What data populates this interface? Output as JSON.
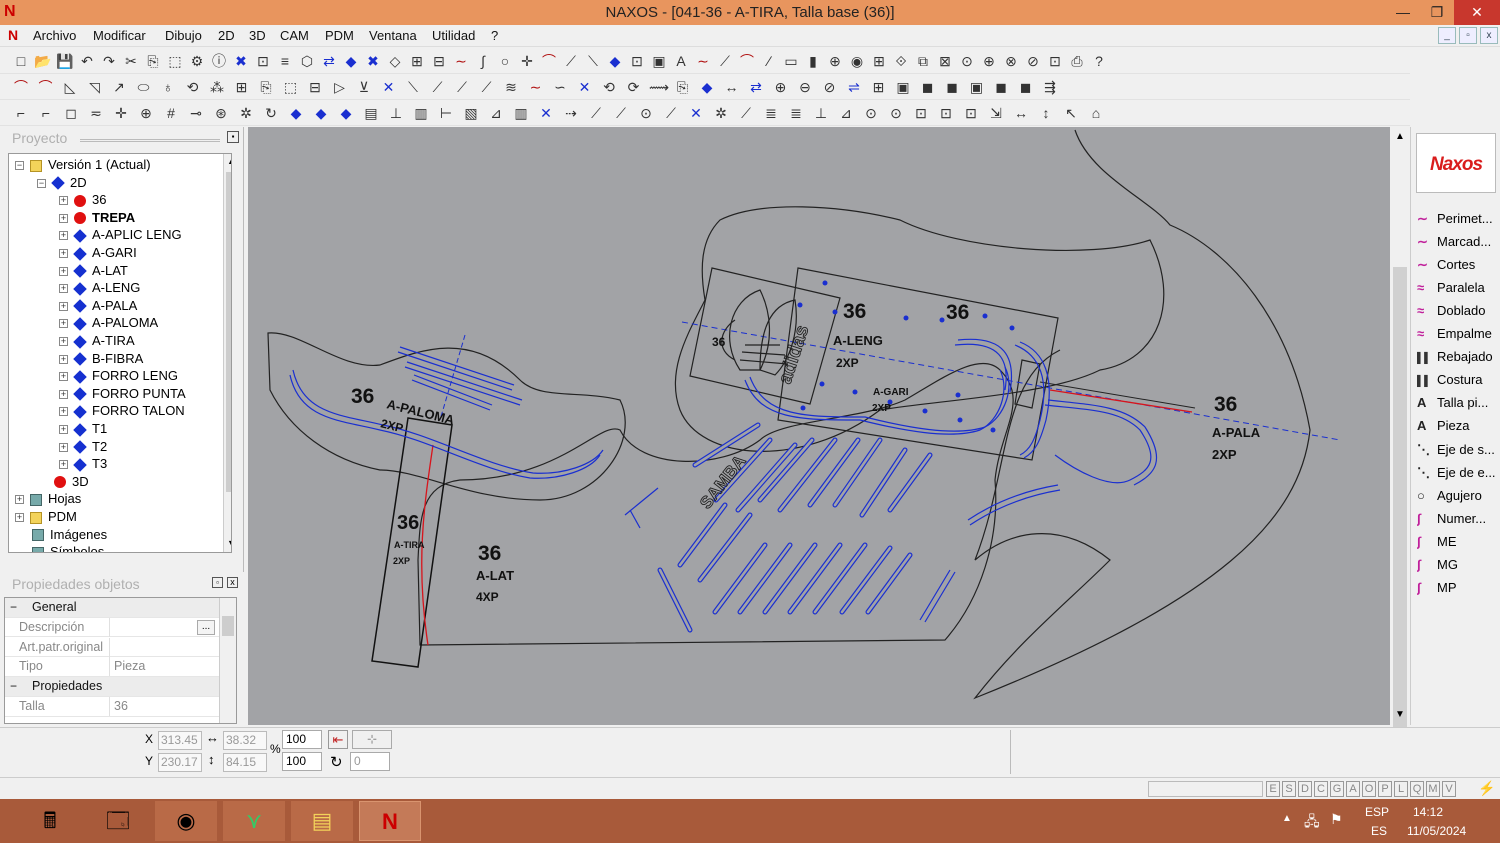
{
  "window": {
    "title": "NAXOS - [041-36 - A-TIRA, Talla base (36)]",
    "minimize": "—",
    "restore": "❐",
    "close": "✕",
    "app_letter": "N"
  },
  "menu": [
    "Archivo",
    "Modificar",
    "Dibujo",
    "2D",
    "3D",
    "CAM",
    "PDM",
    "Ventana",
    "Utilidad",
    "?"
  ],
  "mdi_controls": [
    "_",
    "▫",
    "x"
  ],
  "project_panel": {
    "title": "Proyecto",
    "tree": [
      {
        "label": "Versión 1 (Actual)",
        "indent": 0,
        "icon": "version-icon",
        "expander": "−",
        "bold": false
      },
      {
        "label": "2D",
        "indent": 1,
        "icon": "2d-icon",
        "expander": "−",
        "bold": false
      },
      {
        "label": "36",
        "indent": 2,
        "icon": "size-red-dot-icon",
        "expander": "+",
        "bold": false
      },
      {
        "label": "TREPA",
        "indent": 2,
        "icon": "size-red-dot-icon",
        "expander": "+",
        "bold": true
      },
      {
        "label": "A-APLIC LENG",
        "indent": 2,
        "icon": "piece-diamond-icon",
        "expander": "+",
        "bold": false
      },
      {
        "label": "A-GARI",
        "indent": 2,
        "icon": "piece-diamond-icon",
        "expander": "+",
        "bold": false
      },
      {
        "label": "A-LAT",
        "indent": 2,
        "icon": "piece-diamond-icon",
        "expander": "+",
        "bold": false
      },
      {
        "label": "A-LENG",
        "indent": 2,
        "icon": "piece-diamond-icon",
        "expander": "+",
        "bold": false
      },
      {
        "label": "A-PALA",
        "indent": 2,
        "icon": "piece-diamond-icon",
        "expander": "+",
        "bold": false
      },
      {
        "label": "A-PALOMA",
        "indent": 2,
        "icon": "piece-diamond-icon",
        "expander": "+",
        "bold": false
      },
      {
        "label": "A-TIRA",
        "indent": 2,
        "icon": "piece-diamond-icon",
        "expander": "+",
        "bold": false
      },
      {
        "label": "B-FIBRA",
        "indent": 2,
        "icon": "piece-diamond-icon",
        "expander": "+",
        "bold": false
      },
      {
        "label": "FORRO LENG",
        "indent": 2,
        "icon": "piece-diamond-icon",
        "expander": "+",
        "bold": false
      },
      {
        "label": "FORRO PUNTA",
        "indent": 2,
        "icon": "piece-diamond-icon",
        "expander": "+",
        "bold": false
      },
      {
        "label": "FORRO TALON",
        "indent": 2,
        "icon": "piece-diamond-icon",
        "expander": "+",
        "bold": false
      },
      {
        "label": "T1",
        "indent": 2,
        "icon": "piece-diamond-icon",
        "expander": "+",
        "bold": false
      },
      {
        "label": "T2",
        "indent": 2,
        "icon": "piece-diamond-icon",
        "expander": "+",
        "bold": false
      },
      {
        "label": "T3",
        "indent": 2,
        "icon": "piece-diamond-icon",
        "expander": "+",
        "bold": false
      },
      {
        "label": "3D",
        "indent": 1,
        "icon": "3d-icon",
        "expander": "",
        "bold": false
      },
      {
        "label": "Hojas",
        "indent": 0,
        "icon": "sheets-icon",
        "expander": "+",
        "bold": false
      },
      {
        "label": "PDM",
        "indent": 0,
        "icon": "folder-icon",
        "expander": "+",
        "bold": false
      },
      {
        "label": "Imágenes",
        "indent": 0,
        "icon": "images-icon",
        "expander": "",
        "bold": false
      },
      {
        "label": "Símbolos",
        "indent": 0,
        "icon": "symbols-icon",
        "expander": "",
        "bold": false
      }
    ]
  },
  "props_panel": {
    "title": "Propiedades objetos",
    "rows": [
      {
        "type": "section",
        "label": "General"
      },
      {
        "type": "field",
        "label": "Descripción",
        "value": "",
        "button": "..."
      },
      {
        "type": "field",
        "label": "Art.patr.original",
        "value": ""
      },
      {
        "type": "field",
        "label": "Tipo",
        "value": "Pieza"
      },
      {
        "type": "section",
        "label": "Propiedades"
      },
      {
        "type": "field",
        "label": "Talla",
        "value": "36"
      }
    ]
  },
  "right_panel": {
    "logo": "Naxos",
    "tools": [
      {
        "icon": "∼",
        "label": "Perimet..."
      },
      {
        "icon": "∼",
        "label": "Marcad..."
      },
      {
        "icon": "∼",
        "label": "Cortes"
      },
      {
        "icon": "≈",
        "label": "Paralela"
      },
      {
        "icon": "≈",
        "label": "Doblado"
      },
      {
        "icon": "≈",
        "label": "Empalme"
      },
      {
        "icon": "▌▌",
        "label": "Rebajado"
      },
      {
        "icon": "▌▌",
        "label": "Costura"
      },
      {
        "icon": "A",
        "label": "Talla pi..."
      },
      {
        "icon": "A",
        "label": "Pieza"
      },
      {
        "icon": "⋱",
        "label": "Eje de s..."
      },
      {
        "icon": "⋱",
        "label": "Eje de e..."
      },
      {
        "icon": "○",
        "label": "Agujero"
      },
      {
        "icon": "∫",
        "label": "Numer..."
      },
      {
        "icon": "∫",
        "label": "ME"
      },
      {
        "icon": "∫",
        "label": "MG"
      },
      {
        "icon": "∫",
        "label": "MP"
      }
    ]
  },
  "canvas_labels": [
    {
      "text": "36",
      "cls": "size"
    },
    {
      "text": "36",
      "cls": "size"
    },
    {
      "text": "36",
      "cls": "small"
    },
    {
      "text": "A-LENG",
      "cls": "name"
    },
    {
      "text": "2XP",
      "cls": "name"
    },
    {
      "text": "A-GARI",
      "cls": "tiny"
    },
    {
      "text": "2XP",
      "cls": "tiny"
    },
    {
      "text": "36",
      "cls": "size"
    },
    {
      "text": "A-PALA",
      "cls": "name"
    },
    {
      "text": "2XP",
      "cls": "name"
    },
    {
      "text": "36",
      "cls": "size"
    },
    {
      "text": "A-PALOMA",
      "cls": "name"
    },
    {
      "text": "2XP",
      "cls": "name"
    },
    {
      "text": "36",
      "cls": "size"
    },
    {
      "text": "A-TIRA",
      "cls": "tiny"
    },
    {
      "text": "2XP",
      "cls": "tiny"
    },
    {
      "text": "36",
      "cls": "size"
    },
    {
      "text": "A-LAT",
      "cls": "name"
    },
    {
      "text": "4XP",
      "cls": "name"
    },
    {
      "text": "SAMBA",
      "cls": "brand"
    },
    {
      "text": "adidas",
      "cls": "brand"
    }
  ],
  "status": {
    "x_label": "X",
    "x_value": "313.45",
    "y_label": "Y",
    "y_value": "230.17",
    "w_value": "38.32",
    "h_value": "84.15",
    "percent_sign": "%",
    "scale_x": "100",
    "scale_y": "100",
    "rotation": "0",
    "modes": [
      "E",
      "S",
      "D",
      "C",
      "G",
      "A",
      "O",
      "P",
      "L",
      "Q",
      "M",
      "V"
    ]
  },
  "taskbar": {
    "lang_top": "ESP",
    "lang_bottom": "ES",
    "time": "14:12",
    "date": "11/05/2024"
  }
}
